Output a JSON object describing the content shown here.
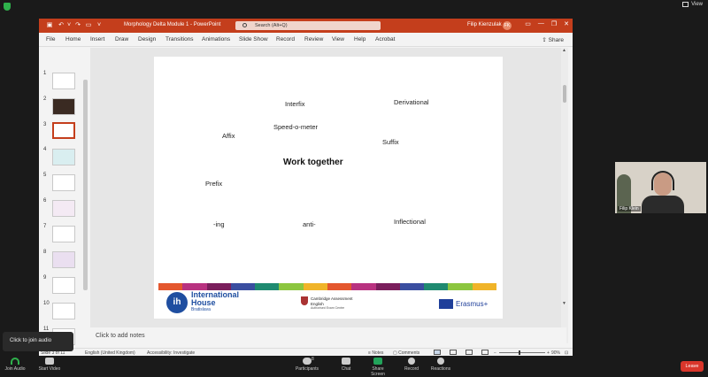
{
  "zoom_top": {
    "view_label": "View"
  },
  "ppt": {
    "doc_title": "Morphology Delta Module 1  -  PowerPoint",
    "search_placeholder": "Search (Alt+Q)",
    "user_name": "Filip Kienzulak",
    "user_initials": "FK",
    "ribbon_tabs": [
      "File",
      "Home",
      "Insert",
      "Draw",
      "Design",
      "Transitions",
      "Animations",
      "Slide Show",
      "Record",
      "Review",
      "View",
      "Help",
      "Acrobat"
    ],
    "share_label": "Share",
    "thumb_numbers": [
      "1",
      "2",
      "3",
      "4",
      "5",
      "6",
      "7",
      "8",
      "9",
      "10",
      "11"
    ],
    "slide": {
      "words": [
        "Interfix",
        "Derivational",
        "Affix",
        "Speed-o-meter",
        "Suffix",
        "Prefix",
        "-ing",
        "anti-",
        "Inflectional"
      ],
      "heading": "Work together",
      "stripe_colors": [
        "#e4572e",
        "#b83280",
        "#7a1f5c",
        "#3a4ea0",
        "#1f8a70",
        "#8cc63f",
        "#f0b429",
        "#e4572e",
        "#b83280",
        "#7a1f5c",
        "#3a4ea0",
        "#1f8a70",
        "#8cc63f",
        "#f0b429"
      ],
      "ih_brand_line1": "International",
      "ih_brand_line2": "House",
      "ih_brand_line3": "Bratislava",
      "cam_line1": "Cambridge Assessment",
      "cam_line2": "English",
      "cam_line3": "Authorised Exam Centre",
      "eu_label": "Erasmus+"
    },
    "notes_placeholder": "Click to add notes",
    "status": {
      "slide_count": "Slide 3 of 11",
      "language": "English (United Kingdom)",
      "accessibility": "Accessibility: Investigate",
      "notes": "Notes",
      "comments": "Comments",
      "zoom": "90%"
    }
  },
  "video": {
    "participant_name": "Filip Klein"
  },
  "tooltip": {
    "text": "Click to join audio"
  },
  "zoom_bar": {
    "join_audio": "Join Audio",
    "start_video": "Start Video",
    "participants": "Participants",
    "participants_count": "8",
    "chat": "Chat",
    "share_screen": "Share Screen",
    "record": "Record",
    "reactions": "Reactions",
    "leave": "Leave",
    "accent": "#22a35a"
  }
}
